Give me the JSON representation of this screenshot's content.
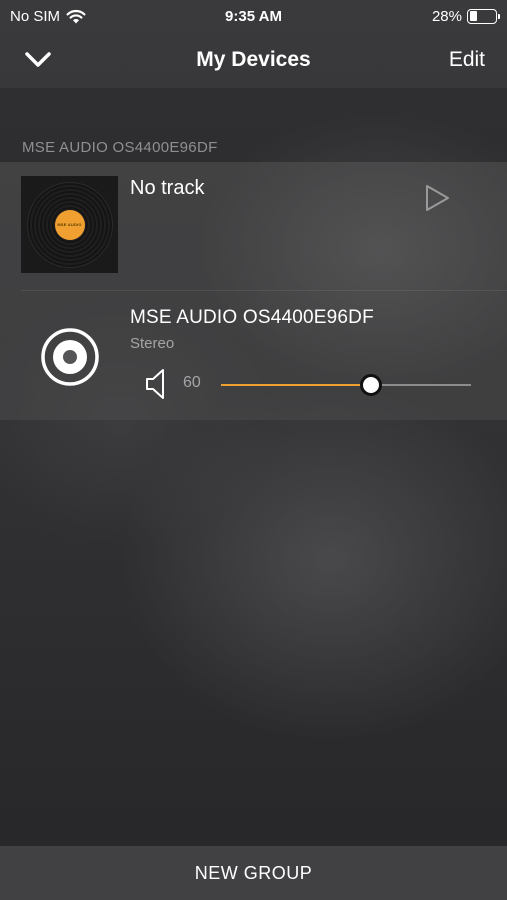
{
  "status_bar": {
    "carrier": "No SIM",
    "time": "9:35 AM",
    "battery": "28%",
    "battery_level": 0.28,
    "icons": [
      "wifi-icon",
      "battery-icon"
    ]
  },
  "nav": {
    "back_icon": "chevron-down-icon",
    "title": "My Devices",
    "edit_label": "Edit"
  },
  "group": {
    "header": "MSE AUDIO OS4400E96DF",
    "now_playing": {
      "track": "No track",
      "album_art_text": "MSE AUDIO",
      "play_icon": "play-icon"
    },
    "device": {
      "name": "MSE AUDIO OS4400E96DF",
      "mode": "Stereo",
      "icon": "speaker-icon",
      "volume_icon": "volume-icon",
      "volume": "60",
      "volume_fraction": 0.6
    }
  },
  "footer": {
    "new_group_label": "NEW GROUP"
  },
  "colors": {
    "accent": "#f0a030",
    "secondary_text": "#a5a5a8",
    "section_header": "#8f8f93"
  }
}
